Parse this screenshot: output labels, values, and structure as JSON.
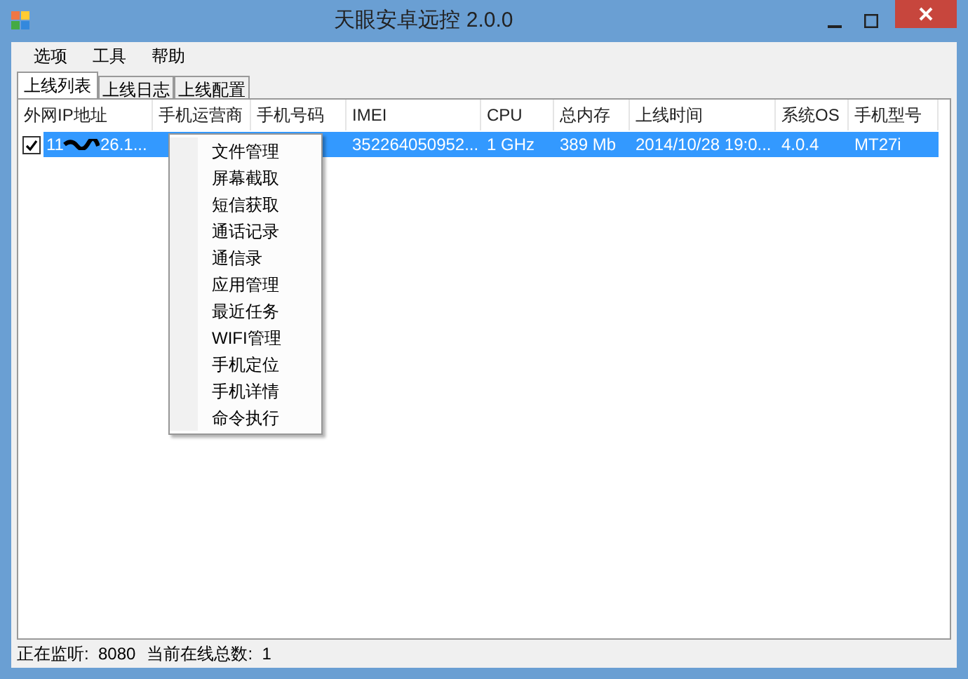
{
  "window": {
    "title": "天眼安卓远控 2.0.0"
  },
  "menu_bar": [
    "选项",
    "工具",
    "帮助"
  ],
  "tabs": [
    {
      "label": "上线列表",
      "selected": true
    },
    {
      "label": "上线日志",
      "selected": false
    },
    {
      "label": "上线配置",
      "selected": false
    }
  ],
  "table": {
    "columns": [
      "外网IP地址",
      "手机运营商",
      "手机号码",
      "IMEI",
      "CPU",
      "总内存",
      "上线时间",
      "系统OS",
      "手机型号"
    ],
    "rows": [
      {
        "checked": true,
        "selected": true,
        "ip_after_scribble": "26.1...",
        "cells": [
          "11",
          "",
          "",
          "352264050952...",
          "1 GHz",
          "389 Mb",
          "2014/10/28 19:0...",
          "4.0.4",
          "MT27i"
        ]
      }
    ]
  },
  "context_menu": [
    "文件管理",
    "屏幕截取",
    "短信获取",
    "通话记录",
    "通信录",
    "应用管理",
    "最近任务",
    "WIFI管理",
    "手机定位",
    "手机详情",
    "命令执行"
  ],
  "status_bar": [
    "正在监听:  8080",
    "当前在线总数:  1"
  ]
}
